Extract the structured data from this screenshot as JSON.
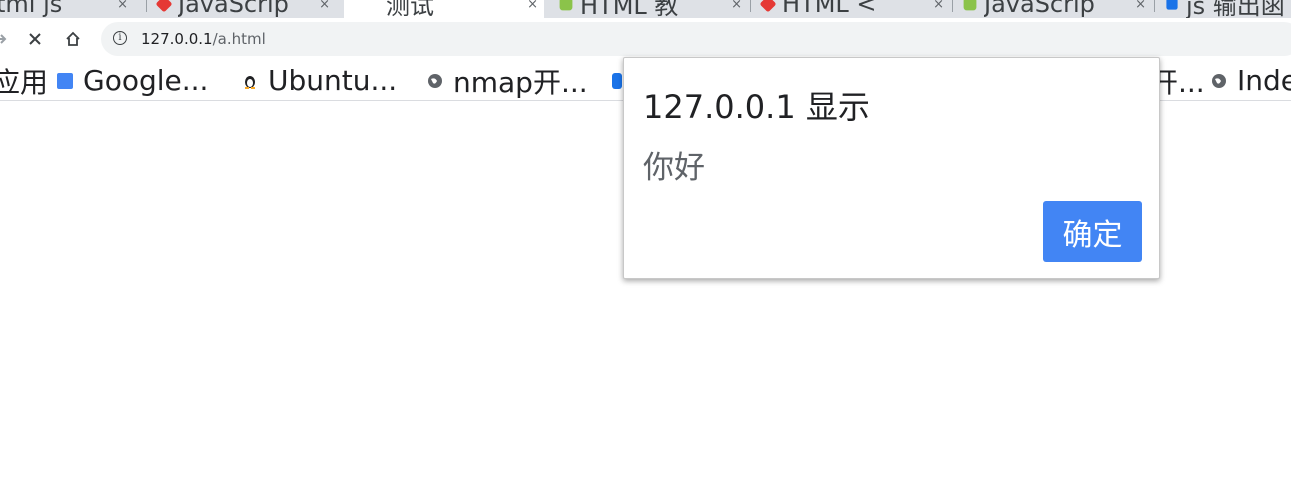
{
  "tabs": [
    {
      "title": "tml js",
      "icon": "page-icon",
      "active": false
    },
    {
      "title": "JavaScrip",
      "icon": "diamond-icon",
      "active": false
    },
    {
      "title": "测试",
      "icon": "none",
      "active": true
    },
    {
      "title": "HTML 教",
      "icon": "leaf-icon",
      "active": false
    },
    {
      "title": "HTML <",
      "icon": "diamond-icon",
      "active": false
    },
    {
      "title": "JavaScrip",
      "icon": "leaf-icon",
      "active": false
    },
    {
      "title": "js 输出函",
      "icon": "blue-icon",
      "active": false
    }
  ],
  "tab_close_glyph": "×",
  "toolbar": {
    "url_host": "127.0.0.1",
    "url_path": "/a.html"
  },
  "bookmarks": [
    {
      "label": "应用",
      "icon": "apps-icon"
    },
    {
      "label": "Google...",
      "icon": "google-translate-icon"
    },
    {
      "label": "Ubuntu...",
      "icon": "penguin-icon"
    },
    {
      "label": "nmap开...",
      "icon": "globe-icon"
    },
    {
      "label": "",
      "icon": "blue-icon"
    },
    {
      "label": "开...",
      "icon": "none"
    },
    {
      "label": "Inde",
      "icon": "globe-icon"
    }
  ],
  "dialog": {
    "title": "127.0.0.1 显示",
    "message": "你好",
    "ok_label": "确定"
  },
  "colors": {
    "accent": "#4285f4",
    "tab_strip": "#dee1e6",
    "omnibox": "#f1f3f4",
    "favicon_red": "#e53935",
    "favicon_green": "#8bc34a",
    "favicon_blue": "#1a73e8"
  }
}
